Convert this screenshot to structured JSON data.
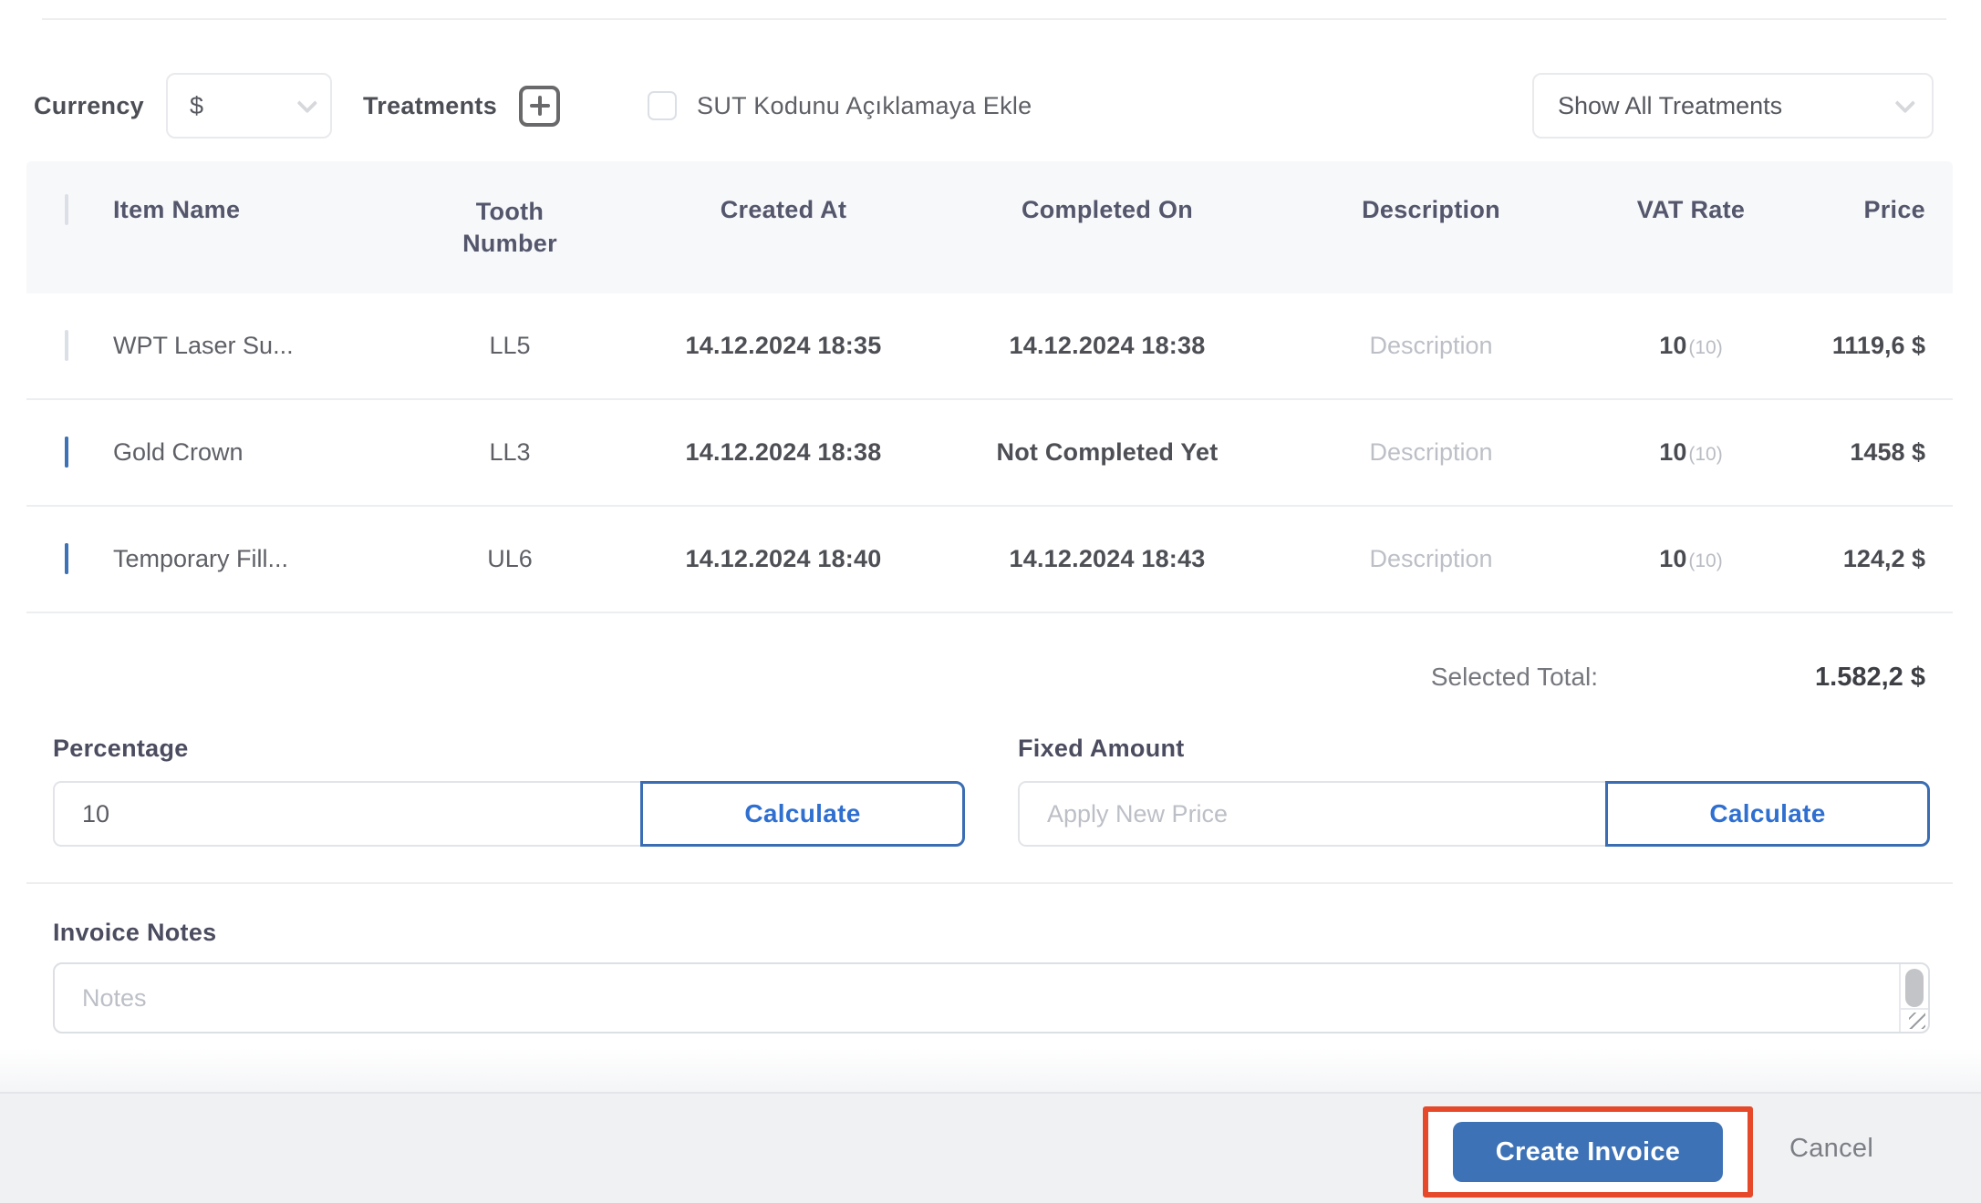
{
  "toolbar": {
    "currency_label": "Currency",
    "currency_value": "$",
    "treatments_label": "Treatments",
    "sut_checkbox_label": "SUT Kodunu Açıklamaya Ekle",
    "sut_checked": false,
    "show_all_treatments_value": "Show All Treatments"
  },
  "table": {
    "headers": {
      "item_name": "Item Name",
      "tooth_number": "Tooth Number",
      "created_at": "Created At",
      "completed_on": "Completed On",
      "description": "Description",
      "vat_rate": "VAT Rate",
      "price": "Price"
    },
    "select_all_checked": false,
    "rows": [
      {
        "checked": false,
        "item_name": "WPT Laser Su...",
        "tooth": "LL5",
        "created_at": "14.12.2024 18:35",
        "completed_on": "14.12.2024 18:38",
        "description_placeholder": "Description",
        "vat": "10",
        "vat_note": "(10)",
        "price": "1119,6 $"
      },
      {
        "checked": true,
        "item_name": "Gold Crown",
        "tooth": "LL3",
        "created_at": "14.12.2024 18:38",
        "completed_on": "Not Completed Yet",
        "description_placeholder": "Description",
        "vat": "10",
        "vat_note": "(10)",
        "price": "1458 $"
      },
      {
        "checked": true,
        "item_name": "Temporary Fill...",
        "tooth": "UL6",
        "created_at": "14.12.2024 18:40",
        "completed_on": "14.12.2024 18:43",
        "description_placeholder": "Description",
        "vat": "10",
        "vat_note": "(10)",
        "price": "124,2 $"
      }
    ]
  },
  "totals": {
    "label": "Selected Total:",
    "value": "1.582,2 $"
  },
  "adjustments": {
    "percentage_label": "Percentage",
    "percentage_value": "10",
    "calculate_label": "Calculate",
    "fixed_amount_label": "Fixed Amount",
    "fixed_amount_placeholder": "Apply New Price"
  },
  "notes": {
    "label": "Invoice Notes",
    "placeholder": "Notes"
  },
  "footer": {
    "create_label": "Create Invoice",
    "cancel_label": "Cancel"
  },
  "icons": {
    "currency_select": "chevron-down",
    "show_all_select": "chevron-down",
    "add_treatment": "plus-square",
    "notes_corner": "resize-grip"
  },
  "colors": {
    "accent": "#3d72b6",
    "calc": "#2f6fd0",
    "red": "#e5492a"
  }
}
